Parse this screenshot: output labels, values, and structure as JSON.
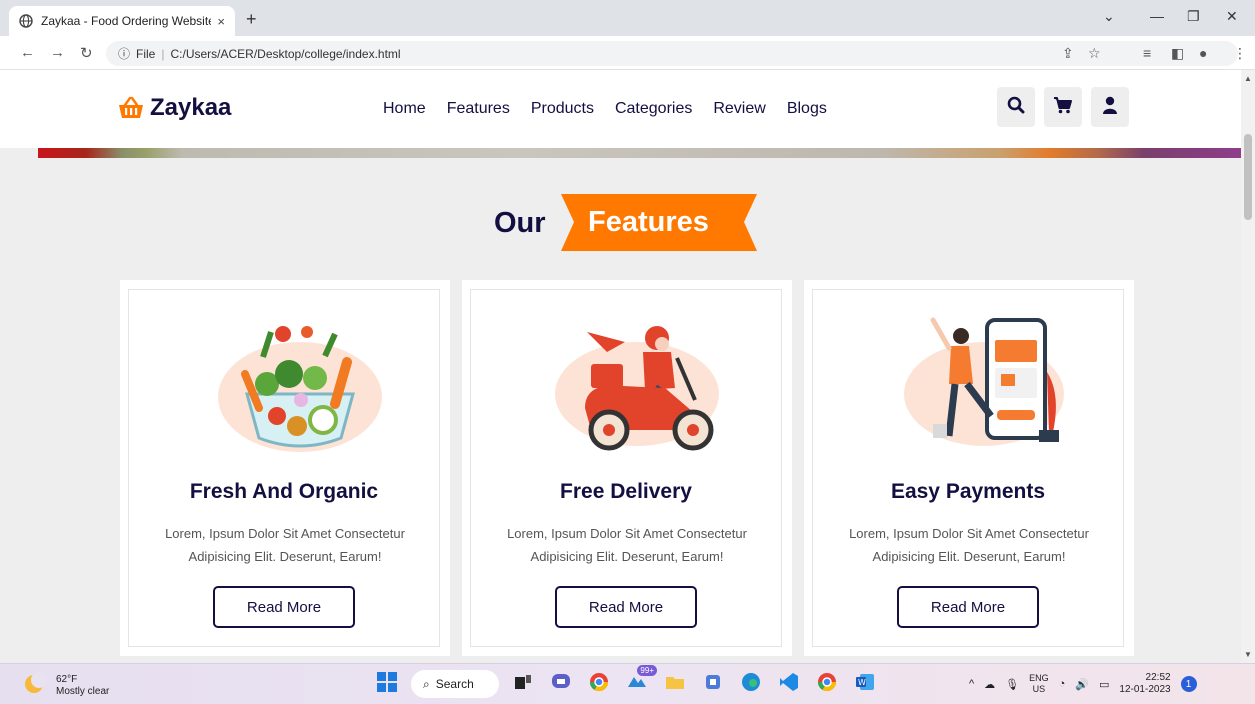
{
  "browser": {
    "tab_title": "Zaykaa - Food Ordering Website",
    "tab_close": "×",
    "new_tab": "+",
    "omnibox_info": "File",
    "omnibox_url": "C:/Users/ACER/Desktop/college/index.html"
  },
  "site": {
    "logo_text": "Zaykaa",
    "nav": [
      "Home",
      "Features",
      "Products",
      "Categories",
      "Review",
      "Blogs"
    ],
    "accent_color": "#ff7800",
    "dark_color": "#130f40"
  },
  "features_section": {
    "heading_part1": "Our",
    "heading_part2": "Features",
    "cards": [
      {
        "title": "Fresh And Organic",
        "text": "Lorem, Ipsum Dolor Sit Amet Consectetur Adipisicing Elit. Deserunt, Earum!",
        "button": "Read More",
        "illustration": "salad-bowl-icon"
      },
      {
        "title": "Free Delivery",
        "text": "Lorem, Ipsum Dolor Sit Amet Consectetur Adipisicing Elit. Deserunt, Earum!",
        "button": "Read More",
        "illustration": "delivery-scooter-icon"
      },
      {
        "title": "Easy Payments",
        "text": "Lorem, Ipsum Dolor Sit Amet Consectetur Adipisicing Elit. Deserunt, Earum!",
        "button": "Read More",
        "illustration": "mobile-payment-icon"
      }
    ]
  },
  "taskbar": {
    "temperature": "62°F",
    "weather": "Mostly clear",
    "search_label": "Search",
    "badge_count": "99+",
    "lang_line1": "ENG",
    "lang_line2": "US",
    "time": "22:52",
    "date": "12-01-2023",
    "notification_count": "1"
  }
}
